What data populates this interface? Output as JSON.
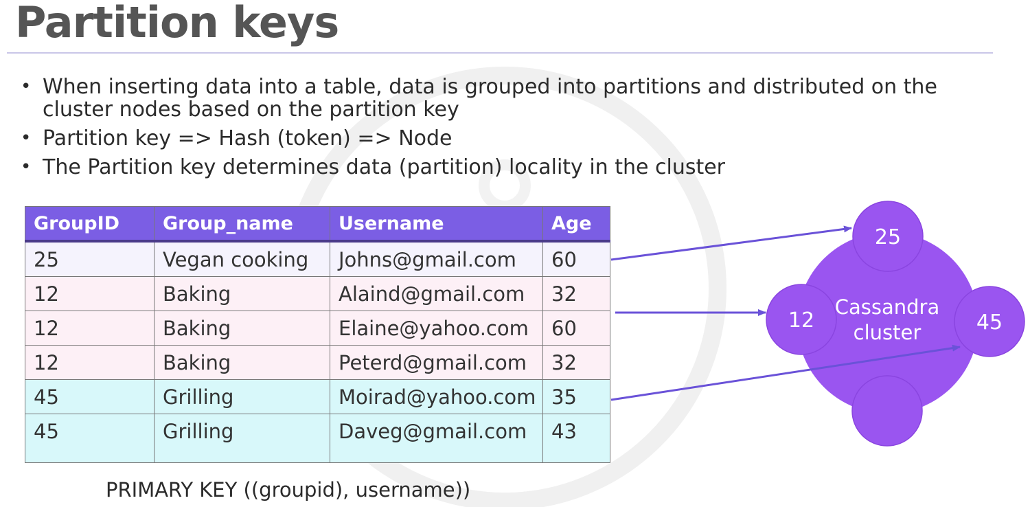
{
  "slide": {
    "title": "Partition keys",
    "bullets": [
      "When inserting data into a table, data is grouped into partitions and distributed on the cluster nodes  based on the partition key",
      "Partition key => Hash (token) => Node",
      "The Partition key determines data (partition) locality in the cluster"
    ]
  },
  "table": {
    "headers": [
      "GroupID",
      "Group_name",
      "Username",
      "Age"
    ],
    "rows": [
      [
        "25",
        "Vegan cooking",
        "Johns@gmail.com",
        "60"
      ],
      [
        "12",
        "Baking",
        "Alaind@gmail.com",
        "32"
      ],
      [
        "12",
        "Baking",
        "Elaine@yahoo.com",
        "60"
      ],
      [
        "12",
        "Baking",
        "Peterd@gmail.com",
        "32"
      ],
      [
        "45",
        "Grilling",
        "Moirad@yahoo.com",
        "35"
      ],
      [
        "45",
        "Grilling",
        "Daveg@gmail.com",
        "43"
      ]
    ]
  },
  "primary_key": "PRIMARY KEY ((groupid), username))",
  "cluster": {
    "label_line1": "Cassandra",
    "label_line2": "cluster",
    "nodes": [
      "25",
      "12",
      "45",
      ""
    ]
  },
  "colors": {
    "header_bg": "#7b5ee4",
    "node_fill": "#9a55f0",
    "arrow": "#6a52d8",
    "row_25": "#f5f3fd",
    "row_12": "#fdf0f6",
    "row_45": "#d8f8fa"
  }
}
